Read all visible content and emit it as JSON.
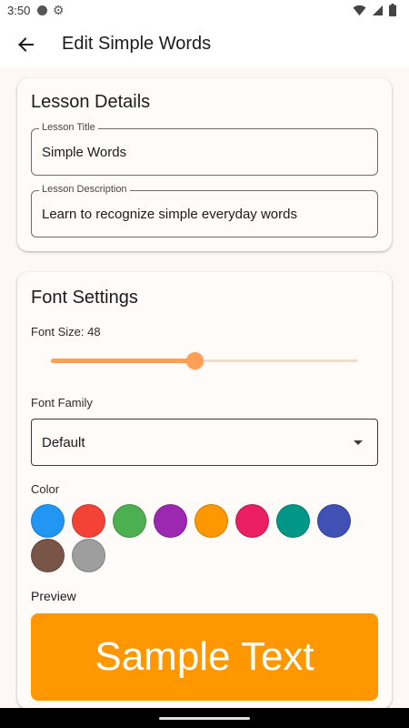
{
  "status_bar": {
    "time": "3:50",
    "icons": [
      "record-icon",
      "settings-icon",
      "wifi-icon",
      "signal-icon",
      "battery-icon"
    ]
  },
  "app_bar": {
    "title": "Edit Simple Words",
    "back_icon": "arrow-back-icon"
  },
  "lesson_details": {
    "title": "Lesson Details",
    "lesson_title_label": "Lesson Title",
    "lesson_title_value": "Simple Words",
    "lesson_description_label": "Lesson Description",
    "lesson_description_value": "Learn to recognize simple everyday words"
  },
  "font_settings": {
    "title": "Font Settings",
    "font_size_label": "Font Size: 48",
    "font_size_value": 48,
    "font_size_fraction": 0.47,
    "font_family_label": "Font Family",
    "font_family_value": "Default",
    "color_label": "Color",
    "colors": [
      "#2196f3",
      "#f44336",
      "#4caf50",
      "#9c27b0",
      "#ff9800",
      "#e91e63",
      "#009688",
      "#3f51b5",
      "#795548",
      "#9e9e9e"
    ],
    "selected_color": "#ff9800",
    "preview_label": "Preview",
    "preview_text": "Sample Text"
  },
  "theme": {
    "accent": "#ff9e55",
    "background": "#fdf8f6"
  }
}
